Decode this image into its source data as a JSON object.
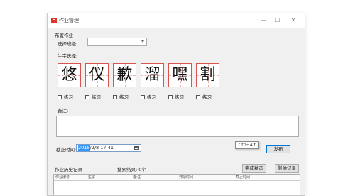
{
  "window": {
    "title": "作业管理",
    "controls": {
      "minimize": "—",
      "maximize": "☐",
      "close": "✕"
    }
  },
  "form": {
    "section_label": "布置作业",
    "class_label": "选择班级:",
    "class_value": "",
    "characters_label": "生字选择:",
    "characters": [
      "悠",
      "仪",
      "歉",
      "溜",
      "嘿",
      "割"
    ],
    "practice_label": "练习",
    "notes_label": "备注:",
    "notes_value": "",
    "deadline_label": "截止时间:",
    "deadline_highlight": "2018",
    "deadline_rest": "/2/8 17:41",
    "publish_button": "发布",
    "tooltip": "Ctrl+Alt"
  },
  "history": {
    "label": "作业历史记录",
    "search_result": "搜索结果: 0个",
    "complete_button": "完成状态",
    "delete_button": "删除记录",
    "columns": [
      "作业编号",
      "生字",
      "备注",
      "开始时间",
      "截止时间"
    ]
  },
  "colors": {
    "char_border": "#d9534f",
    "accent": "#0078d7",
    "selection": "#3399ff"
  }
}
